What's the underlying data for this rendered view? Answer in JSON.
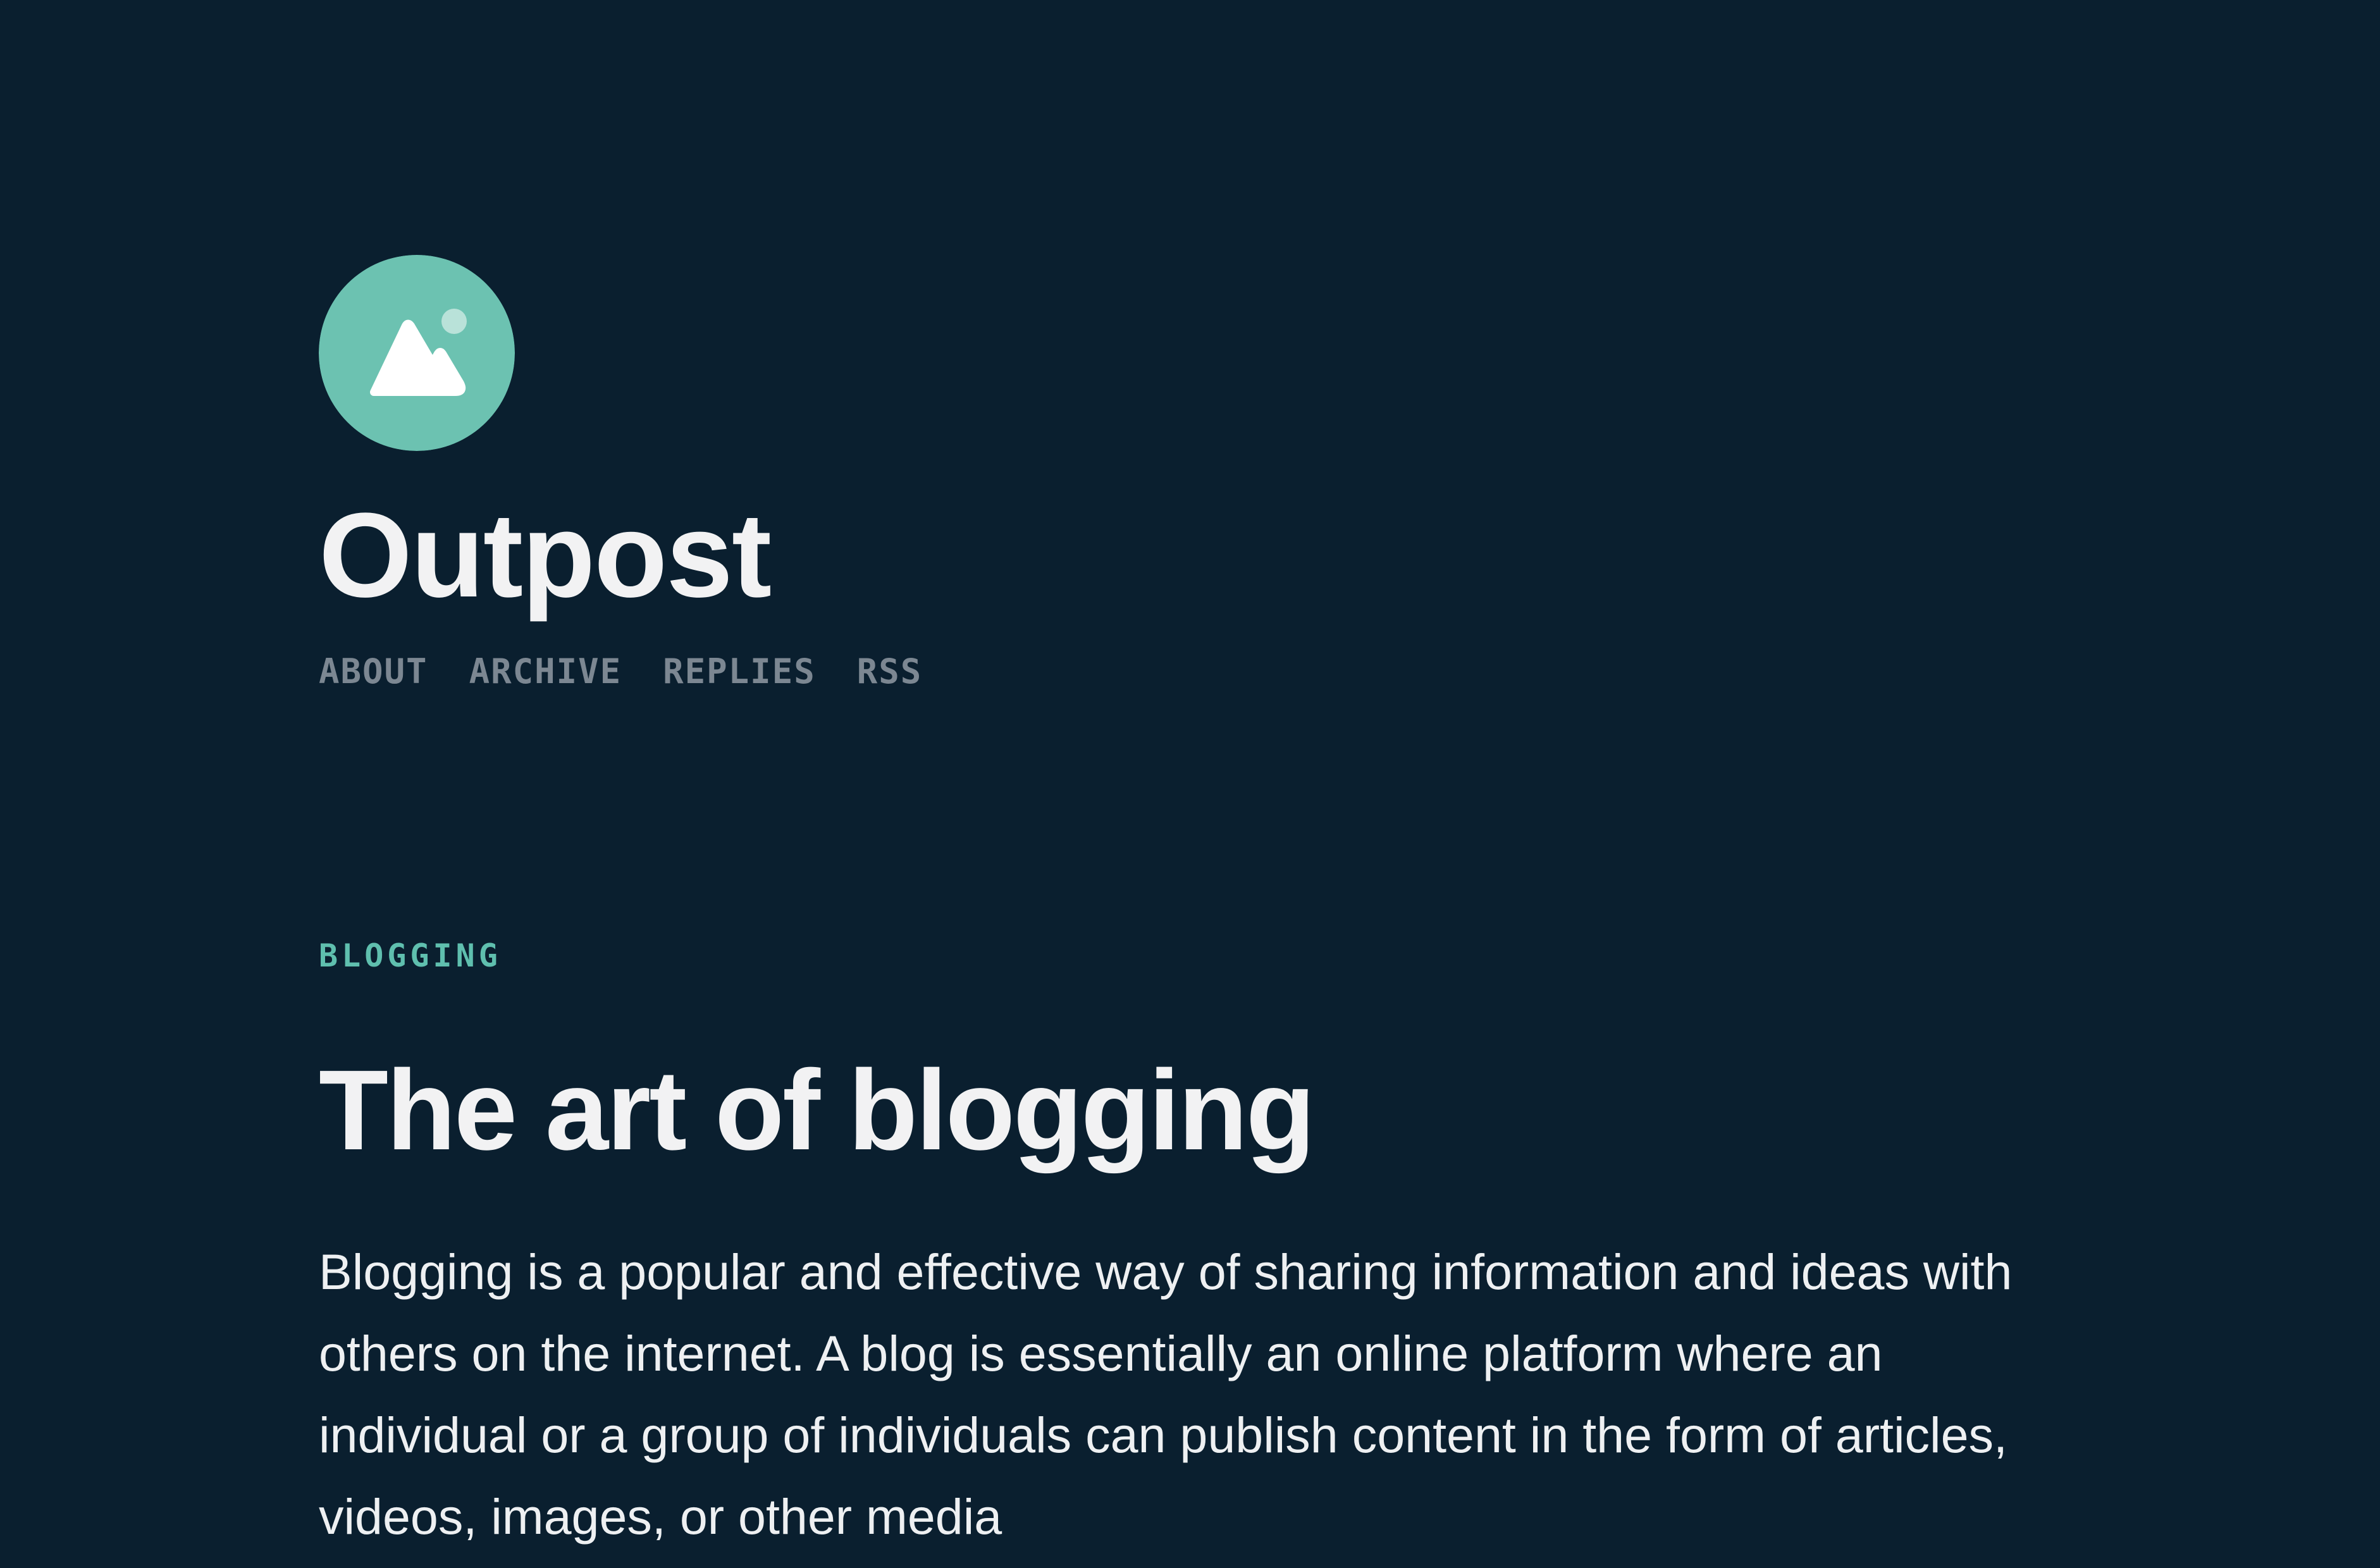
{
  "site": {
    "title": "Outpost",
    "logo_icon": "mountain-icon",
    "colors": {
      "background": "#0a1f2f",
      "accent": "#6cc2b1",
      "nav": "#7c8792",
      "text": "#f2f2f3"
    }
  },
  "nav": {
    "items": [
      {
        "label": "ABOUT"
      },
      {
        "label": "ARCHIVE"
      },
      {
        "label": "REPLIES"
      },
      {
        "label": "RSS"
      }
    ]
  },
  "post": {
    "category": "BLOGGING",
    "title": "The art of blogging",
    "body": "Blogging is a popular and effective way of sharing information and ideas with others on the internet. A blog is essentially an online platform where an individual or a group of individuals can publish content in the form of articles, videos, images, or other media"
  }
}
